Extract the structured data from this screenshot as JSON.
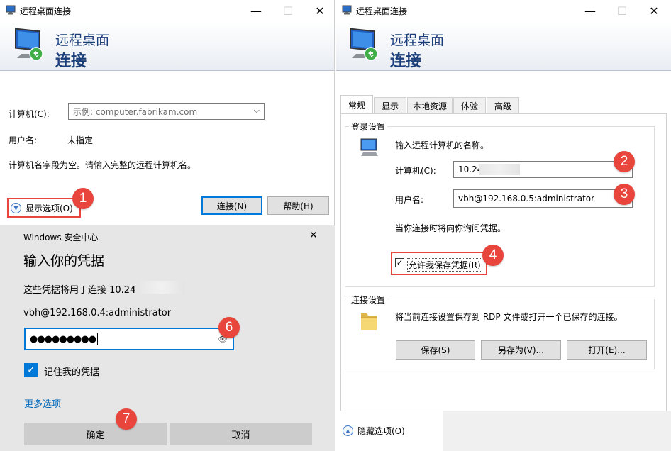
{
  "left_window": {
    "title": "远程桌面连接",
    "banner_line1": "远程桌面",
    "banner_line2": "连接",
    "computer_label": "计算机(C):",
    "computer_placeholder": "示例: computer.fabrikam.com",
    "username_label": "用户名:",
    "username_value": "未指定",
    "hint": "计算机名字段为空。请输入完整的远程计算机名。",
    "show_options": "显示选项(O)",
    "connect_button": "连接(N)",
    "help_button": "帮助(H)"
  },
  "security_dialog": {
    "header": "Windows 安全中心",
    "title": "输入你的凭据",
    "used_for": "这些凭据将用于连接 10.24",
    "account": "vbh@192.168.0.4:administrator",
    "password_mask": "●●●●●●●●●",
    "remember": "记住我的凭据",
    "more_options": "更多选项",
    "ok_button": "确定",
    "cancel_button": "取消"
  },
  "right_window": {
    "title": "远程桌面连接",
    "banner_line1": "远程桌面",
    "banner_line2": "连接",
    "tabs": [
      {
        "label": "常规"
      },
      {
        "label": "显示"
      },
      {
        "label": "本地资源"
      },
      {
        "label": "体验"
      },
      {
        "label": "高级"
      }
    ],
    "login_group": "登录设置",
    "login_intro": "输入远程计算机的名称。",
    "computer_label": "计算机(C):",
    "computer_value": "10.24",
    "username_label": "用户名:",
    "username_value": "vbh@192.168.0.5:administrator",
    "prompt_note": "当你连接时将向你询问凭据。",
    "allow_save": "允许我保存凭据(R)",
    "connection_group": "连接设置",
    "connection_note": "将当前连接设置保存到 RDP 文件或打开一个已保存的连接。",
    "save_button": "保存(S)",
    "saveas_button": "另存为(V)...",
    "open_button": "打开(E)...",
    "hide_options": "隐藏选项(O)"
  },
  "annotations": [
    "1",
    "2",
    "3",
    "4",
    "6",
    "7"
  ],
  "colors": {
    "accent": "#0078d7",
    "annotation_red": "#e8453c",
    "banner_text": "#1a3e7a"
  }
}
